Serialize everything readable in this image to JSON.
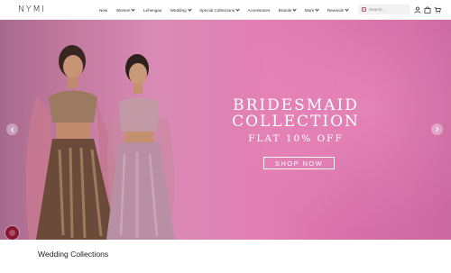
{
  "brand": {
    "logo_text": "NYMI"
  },
  "nav": {
    "items": [
      {
        "label": "New",
        "has_dropdown": false
      },
      {
        "label": "Women",
        "has_dropdown": true
      },
      {
        "label": "Lehengas",
        "has_dropdown": false
      },
      {
        "label": "Wedding",
        "has_dropdown": true
      },
      {
        "label": "Special Collections",
        "has_dropdown": true
      },
      {
        "label": "Accessories",
        "has_dropdown": false
      },
      {
        "label": "Brands",
        "has_dropdown": true
      },
      {
        "label": "More",
        "has_dropdown": true
      },
      {
        "label": "Rewards",
        "has_dropdown": true
      }
    ]
  },
  "search": {
    "placeholder": "Search..."
  },
  "header_icons": [
    "user-icon",
    "bag-icon",
    "cart-icon"
  ],
  "hero": {
    "title_line1": "BRIDESMAID",
    "title_line2": "COLLECTION",
    "subtitle": "FLAT 10% OFF",
    "cta_label": "SHOP NOW"
  },
  "section": {
    "title": "Wedding Collections"
  },
  "colors": {
    "accent": "#c24b7a",
    "hero_pink": "#e27db2",
    "chat_bubble": "#8a1530"
  }
}
